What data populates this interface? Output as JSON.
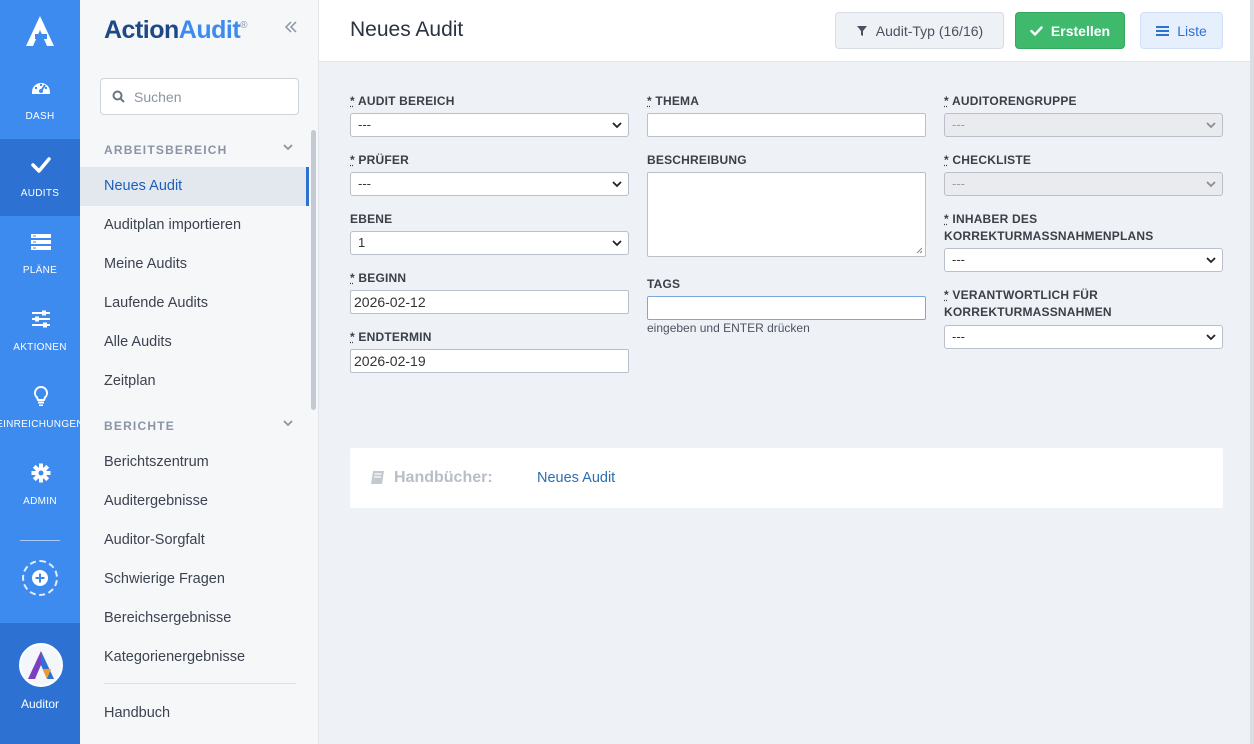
{
  "rail": {
    "items": [
      {
        "label": "DASH",
        "icon": "dashboard-gauge-icon"
      },
      {
        "label": "AUDITS",
        "icon": "check-icon"
      },
      {
        "label": "PLÄNE",
        "icon": "plans-list-icon"
      },
      {
        "label": "AKTIONEN",
        "icon": "sliders-icon"
      },
      {
        "label": "EINREICHUNGEN",
        "icon": "lightbulb-icon"
      },
      {
        "label": "ADMIN",
        "icon": "gear-icon"
      }
    ],
    "user": "Auditor"
  },
  "sidebar": {
    "brand_part1": "Action",
    "brand_part2": "Audit",
    "brand_reg": "®",
    "search_placeholder": "Suchen",
    "sections": [
      {
        "title": "ARBEITSBEREICH",
        "items": [
          "Neues Audit",
          "Auditplan importieren",
          "Meine Audits",
          "Laufende Audits",
          "Alle Audits",
          "Zeitplan"
        ]
      },
      {
        "title": "BERICHTE",
        "items": [
          "Berichtszentrum",
          "Auditergebnisse",
          "Auditor-Sorgfalt",
          "Schwierige Fragen",
          "Bereichsergebnisse",
          "Kategorienergebnisse"
        ]
      }
    ],
    "footer_item": "Handbuch"
  },
  "header": {
    "title": "Neues Audit",
    "filter_label": "Audit-Typ (16/16)",
    "create_label": "Erstellen",
    "list_label": "Liste"
  },
  "form": {
    "col1": {
      "bereich_label": "AUDIT BEREICH",
      "bereich_value": "---",
      "pruefer_label": "PRÜFER",
      "pruefer_value": "---",
      "ebene_label": "EBENE",
      "ebene_value": "1",
      "beginn_label": "BEGINN",
      "beginn_value": "2026-02-12",
      "endtermin_label": "ENDTERMIN",
      "endtermin_value": "2026-02-19"
    },
    "col2": {
      "thema_label": "THEMA",
      "thema_value": "",
      "beschreibung_label": "BESCHREIBUNG",
      "tags_label": "TAGS",
      "tags_hint": "eingeben und ENTER drücken"
    },
    "col3": {
      "gruppe_label": "AUDITORENGRUPPE",
      "gruppe_value": "---",
      "checkliste_label": "CHECKLISTE",
      "checkliste_value": "---",
      "inhaber_label_1": "INHABER DES",
      "inhaber_label_2": "KORREKTURMASSNAHMENPLANS",
      "inhaber_value": "---",
      "verantw_label_1": "VERANTWORTLICH FÜR",
      "verantw_label_2": "KORREKTURMASSNAHMEN",
      "verantw_value": "---"
    },
    "required_mark": "*"
  },
  "manual": {
    "label": "Handbücher:",
    "link": "Neues Audit"
  },
  "colors": {
    "rail": "#3d8bef",
    "rail_active": "#2d72d2",
    "create": "#3fba6d",
    "brand_dark": "#1d4a85"
  }
}
